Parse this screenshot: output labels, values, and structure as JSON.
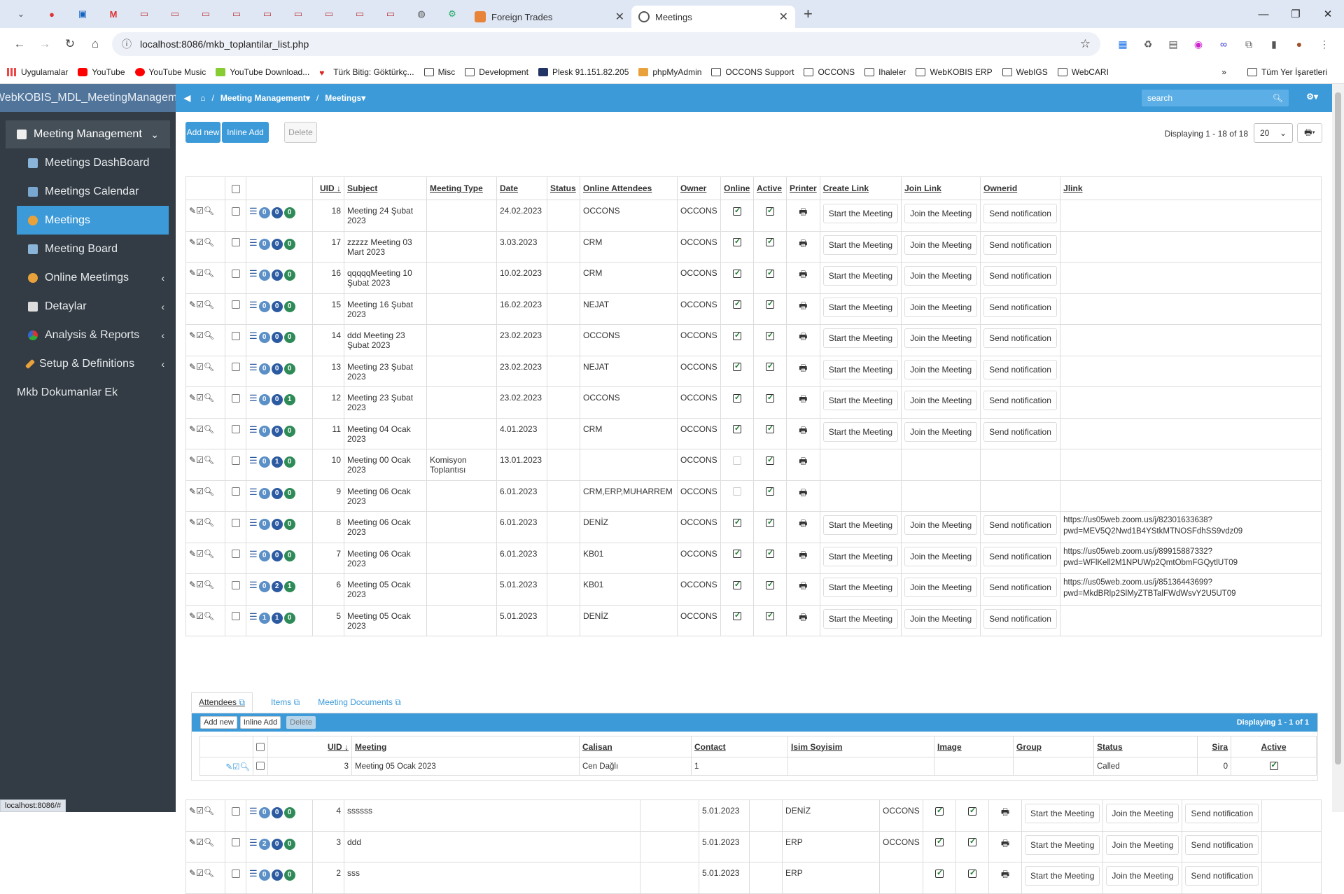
{
  "browser": {
    "tabs": [
      {
        "label": "Foreign Trades",
        "icon": "orange-square-icon"
      },
      {
        "label": "Meetings",
        "icon": "globe-icon",
        "active": true
      }
    ],
    "url": "localhost:8086/mkb_toplantilar_list.php",
    "status_url": "localhost:8086/#"
  },
  "bookmarks": [
    "Uygulamalar",
    "YouTube",
    "YouTube Music",
    "YouTube Download...",
    "Türk Bitig: Göktürkç...",
    "Misc",
    "Development",
    "Plesk 91.151.82.205",
    "phpMyAdmin",
    "OCCONS Support",
    "OCCONS",
    "Ihaleler",
    "WebKOBIS ERP",
    "WebIGS",
    "WebCARI",
    "Tüm Yer İşaretleri"
  ],
  "app": {
    "brand": "WebKOBIS_MDL_MeetingManagement",
    "breadcrumb": [
      "Meeting Management",
      "Meetings"
    ],
    "search_placeholder": "search"
  },
  "sidebar": {
    "items": [
      {
        "label": "Meeting Management"
      },
      {
        "label": "Meetings DashBoard"
      },
      {
        "label": "Meetings Calendar"
      },
      {
        "label": "Meetings"
      },
      {
        "label": "Meeting Board"
      },
      {
        "label": "Online Meetimgs"
      },
      {
        "label": "Detaylar"
      },
      {
        "label": "Analysis & Reports"
      },
      {
        "label": "Setup & Definitions"
      },
      {
        "label": "Mkb Dokumanlar Ek"
      }
    ]
  },
  "toolbar": {
    "add_new": "Add new",
    "inline_add": "Inline Add",
    "delete": "Delete",
    "displaying": "Displaying 1 - 18 of 18",
    "page_size": "20"
  },
  "columns": [
    "UID",
    "Subject",
    "Meeting Type",
    "Date",
    "Status",
    "Online Attendees",
    "Owner",
    "Online",
    "Active",
    "Printer",
    "Create Link",
    "Join Link",
    "Ownerid",
    "Jlink"
  ],
  "link_labels": {
    "start": "Start the Meeting",
    "join": "Join the Meeting",
    "notify": "Send notification"
  },
  "rows": [
    {
      "uid": "18",
      "subject": "Meeting 24 Şubat 2023",
      "type": "",
      "date": "24.02.2023",
      "attendees": "OCCONS",
      "owner": "OCCONS",
      "b": [
        "0",
        "0",
        "0"
      ],
      "online": true,
      "active": true,
      "links": true,
      "jlink": ""
    },
    {
      "uid": "17",
      "subject": "zzzzz Meeting 03 Mart 2023",
      "type": "",
      "date": "3.03.2023",
      "attendees": "CRM",
      "owner": "OCCONS",
      "b": [
        "0",
        "0",
        "0"
      ],
      "online": true,
      "active": true,
      "links": true,
      "jlink": ""
    },
    {
      "uid": "16",
      "subject": "qqqqqMeeting 10 Şubat 2023",
      "type": "",
      "date": "10.02.2023",
      "attendees": "CRM",
      "owner": "OCCONS",
      "b": [
        "0",
        "0",
        "0"
      ],
      "online": true,
      "active": true,
      "links": true,
      "jlink": ""
    },
    {
      "uid": "15",
      "subject": "Meeting 16 Şubat 2023",
      "type": "",
      "date": "16.02.2023",
      "attendees": "NEJAT",
      "owner": "OCCONS",
      "b": [
        "0",
        "0",
        "0"
      ],
      "online": true,
      "active": true,
      "links": true,
      "jlink": ""
    },
    {
      "uid": "14",
      "subject": "ddd Meeting 23 Şubat 2023",
      "type": "",
      "date": "23.02.2023",
      "attendees": "OCCONS",
      "owner": "OCCONS",
      "b": [
        "0",
        "0",
        "0"
      ],
      "online": true,
      "active": true,
      "links": true,
      "jlink": ""
    },
    {
      "uid": "13",
      "subject": "Meeting 23 Şubat 2023",
      "type": "",
      "date": "23.02.2023",
      "attendees": "NEJAT",
      "owner": "OCCONS",
      "b": [
        "0",
        "0",
        "0"
      ],
      "online": true,
      "active": true,
      "links": true,
      "jlink": ""
    },
    {
      "uid": "12",
      "subject": "Meeting 23 Şubat 2023",
      "type": "",
      "date": "23.02.2023",
      "attendees": "OCCONS",
      "owner": "OCCONS",
      "b": [
        "0",
        "0",
        "1"
      ],
      "online": true,
      "active": true,
      "links": true,
      "jlink": ""
    },
    {
      "uid": "11",
      "subject": "Meeting 04 Ocak 2023",
      "type": "",
      "date": "4.01.2023",
      "attendees": "CRM",
      "owner": "OCCONS",
      "b": [
        "0",
        "0",
        "0"
      ],
      "online": true,
      "active": true,
      "links": true,
      "jlink": ""
    },
    {
      "uid": "10",
      "subject": "Meeting 00 Ocak 2023",
      "type": "Komisyon Toplantısı",
      "date": "13.01.2023",
      "attendees": "",
      "owner": "OCCONS",
      "b": [
        "0",
        "1",
        "0"
      ],
      "online": false,
      "active": true,
      "links": false,
      "jlink": ""
    },
    {
      "uid": "9",
      "subject": "Meeting 06 Ocak 2023",
      "type": "",
      "date": "6.01.2023",
      "attendees": "CRM,ERP,MUHARREM",
      "owner": "OCCONS",
      "b": [
        "0",
        "0",
        "0"
      ],
      "online": false,
      "active": true,
      "links": false,
      "jlink": ""
    },
    {
      "uid": "8",
      "subject": "Meeting 06 Ocak 2023",
      "type": "",
      "date": "6.01.2023",
      "attendees": "DENİZ",
      "owner": "OCCONS",
      "b": [
        "0",
        "0",
        "0"
      ],
      "online": true,
      "active": true,
      "links": true,
      "jlink": "https://us05web.zoom.us/j/82301633638?pwd=MEV5Q2Nwd1B4YStkMTNOSFdhSS9vdz09"
    },
    {
      "uid": "7",
      "subject": "Meeting 06 Ocak 2023",
      "type": "",
      "date": "6.01.2023",
      "attendees": "KB01",
      "owner": "OCCONS",
      "b": [
        "0",
        "0",
        "0"
      ],
      "online": true,
      "active": true,
      "links": true,
      "jlink": "https://us05web.zoom.us/j/89915887332?pwd=WFlKell2M1NPUWp2QmtObmFGQytlUT09"
    },
    {
      "uid": "6",
      "subject": "Meeting 05 Ocak 2023",
      "type": "",
      "date": "5.01.2023",
      "attendees": "KB01",
      "owner": "OCCONS",
      "b": [
        "0",
        "2",
        "1"
      ],
      "online": true,
      "active": true,
      "links": true,
      "jlink": "https://us05web.zoom.us/j/85136443699?pwd=MkdBRlp2SlMyZTBTalFWdWsvY2U5UT09"
    },
    {
      "uid": "5",
      "subject": "Meeting 05 Ocak 2023",
      "type": "",
      "date": "5.01.2023",
      "attendees": "DENİZ",
      "owner": "OCCONS",
      "b": [
        "1",
        "1",
        "0"
      ],
      "online": true,
      "active": true,
      "links": true,
      "jlink": ""
    }
  ],
  "detail": {
    "tabs": [
      "Attendees",
      "Items",
      "Meeting Documents"
    ],
    "add_new": "Add new",
    "inline_add": "Inline Add",
    "delete": "Delete",
    "displaying": "Displaying 1 - 1 of 1",
    "columns": [
      "UID",
      "Meeting",
      "Calisan",
      "Contact",
      "Isim Soyisim",
      "Image",
      "Group",
      "Status",
      "Sira",
      "Active"
    ],
    "row": {
      "uid": "3",
      "meeting": "Meeting 05 Ocak 2023",
      "calisan": "Cen Dağlı",
      "contact": "1",
      "isim": "",
      "image": "",
      "group": "",
      "status": "Called",
      "sira": "0",
      "active": true
    }
  },
  "rows_after": [
    {
      "uid": "4",
      "subject": "ssssss",
      "date": "5.01.2023",
      "attendees": "DENİZ",
      "owner": "OCCONS",
      "b": [
        "0",
        "0",
        "0"
      ],
      "online": true,
      "active": true
    },
    {
      "uid": "3",
      "subject": "ddd",
      "date": "5.01.2023",
      "attendees": "ERP",
      "owner": "OCCONS",
      "b": [
        "2",
        "0",
        "0"
      ],
      "online": true,
      "active": true
    },
    {
      "uid": "2",
      "subject": "sss",
      "date": "5.01.2023",
      "attendees": "ERP",
      "owner": "",
      "b": [
        "0",
        "0",
        "0"
      ],
      "online": true,
      "active": true
    }
  ]
}
